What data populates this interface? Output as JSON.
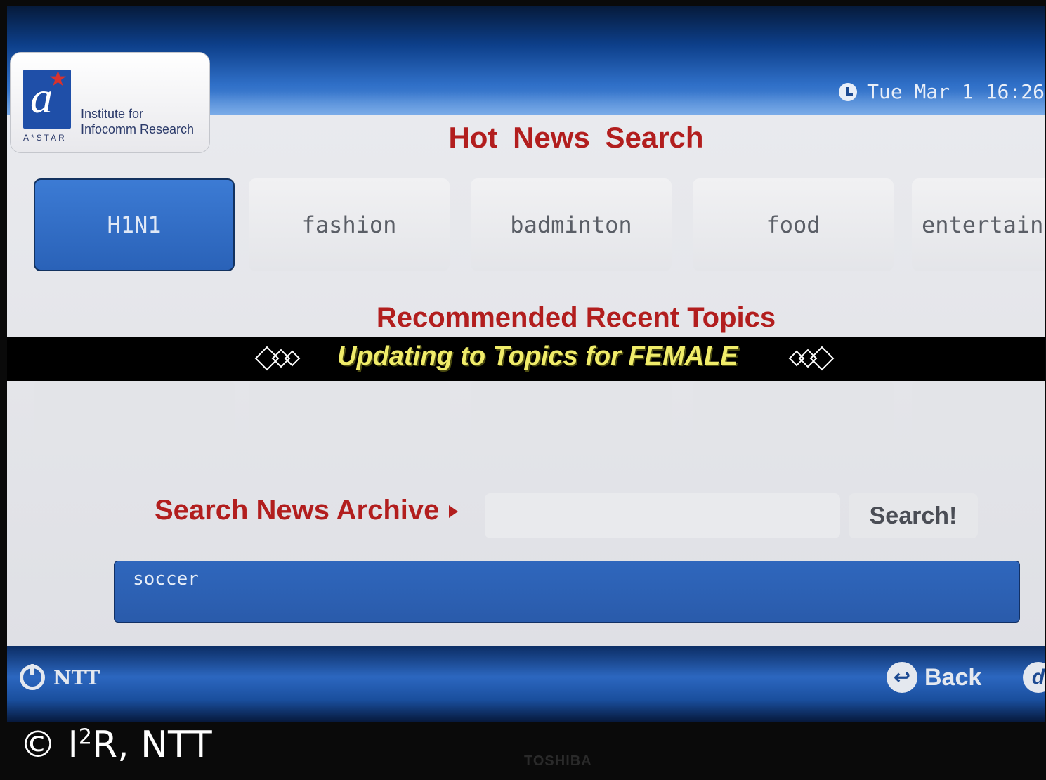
{
  "app": {
    "title": "Hot News Search",
    "logo_text_line1": "Institute for",
    "logo_text_line2": "Infocomm Research",
    "logo_sub": "A*STAR",
    "clock": "Tue Mar  1 16:26"
  },
  "tabs": [
    {
      "label": "H1N1",
      "active": true
    },
    {
      "label": "fashion",
      "active": false
    },
    {
      "label": "badminton",
      "active": false
    },
    {
      "label": "food",
      "active": false
    },
    {
      "label": "entertainment",
      "active": false
    }
  ],
  "recommended": {
    "title": "Recommended Recent Topics",
    "ticker": "Updating to Topics for FEMALE"
  },
  "archive": {
    "label": "Search News Archive",
    "input_value": "",
    "button_label": "Search!",
    "results": [
      "soccer"
    ]
  },
  "footer": {
    "ntt_label": "NTT",
    "back_label": "Back",
    "d_label": "d"
  },
  "overlay": {
    "copyright_prefix": "© I",
    "copyright_sup": "2",
    "copyright_suffix": "R, NTT",
    "brand": "TOSHIBA"
  },
  "colors": {
    "accent_red": "#b21e1e",
    "tab_active_blue": "#2a62b8",
    "ticker_yellow": "#f0ec6a"
  }
}
